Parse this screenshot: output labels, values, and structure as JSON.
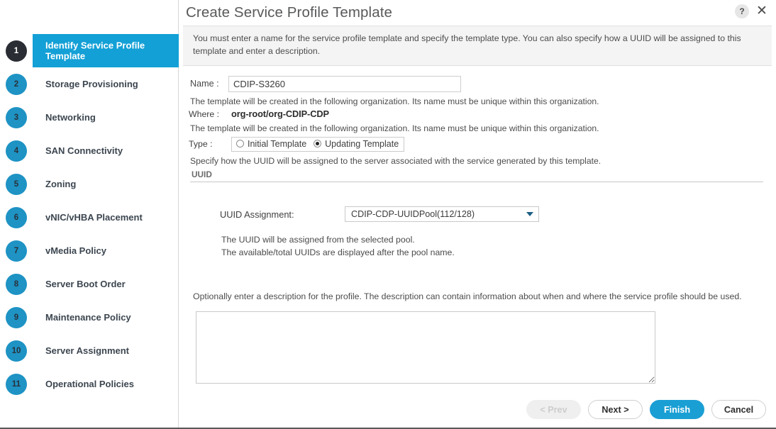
{
  "window": {
    "title": "Create Service Profile Template",
    "help_icon": "question-mark-icon",
    "close_icon": "close-x-icon",
    "notice": "You must enter a name for the service profile template and specify the template type. You can also specify how a UUID will be assigned to this template and enter a description."
  },
  "sidebar": {
    "items": [
      {
        "number": "1",
        "label": "Identify Service Profile Template",
        "active": true
      },
      {
        "number": "2",
        "label": "Storage Provisioning",
        "active": false
      },
      {
        "number": "3",
        "label": "Networking",
        "active": false
      },
      {
        "number": "4",
        "label": "SAN Connectivity",
        "active": false
      },
      {
        "number": "5",
        "label": "Zoning",
        "active": false
      },
      {
        "number": "6",
        "label": "vNIC/vHBA Placement",
        "active": false
      },
      {
        "number": "7",
        "label": "vMedia Policy",
        "active": false
      },
      {
        "number": "8",
        "label": "Server Boot Order",
        "active": false
      },
      {
        "number": "9",
        "label": "Maintenance Policy",
        "active": false
      },
      {
        "number": "10",
        "label": "Server Assignment",
        "active": false
      },
      {
        "number": "11",
        "label": "Operational Policies",
        "active": false
      }
    ]
  },
  "form": {
    "name_label": "Name :",
    "name_value": "CDIP-S3260",
    "org_hint_1": "The template will be created in the following organization. Its name must be unique within this organization.",
    "where_label": "Where :",
    "where_value": "org-root/org-CDIP-CDP",
    "org_hint_2": "The template will be created in the following organization. Its name must be unique within this organization.",
    "type_label": "Type   :",
    "type_options": [
      {
        "label": "Initial Template",
        "selected": false
      },
      {
        "label": "Updating Template",
        "selected": true
      }
    ],
    "uuid_hint": "Specify how the UUID will be assigned to the server associated with the service generated by this template.",
    "uuid_section_label": "UUID"
  },
  "uuid": {
    "assignment_label": "UUID Assignment:",
    "assignment_value": "CDIP-CDP-UUIDPool(112/128)",
    "caret_icon": "chevron-down-icon",
    "note_1": "The UUID will be assigned from the selected pool.",
    "note_2": "The available/total UUIDs are displayed after the pool name."
  },
  "description": {
    "intro": "Optionally enter a description for the profile. The description can contain information about when and where the service profile should be used.",
    "value": "",
    "placeholder": ""
  },
  "footer": {
    "prev_label": "< Prev",
    "next_label": "Next >",
    "finish_label": "Finish",
    "cancel_label": "Cancel"
  },
  "colors": {
    "accent": "#13a0d6",
    "accent_button": "#1a9fd4",
    "badge_inactive": "#1e93c4",
    "badge_active": "#2a2d33",
    "notice_bg": "#f4f4f4"
  }
}
